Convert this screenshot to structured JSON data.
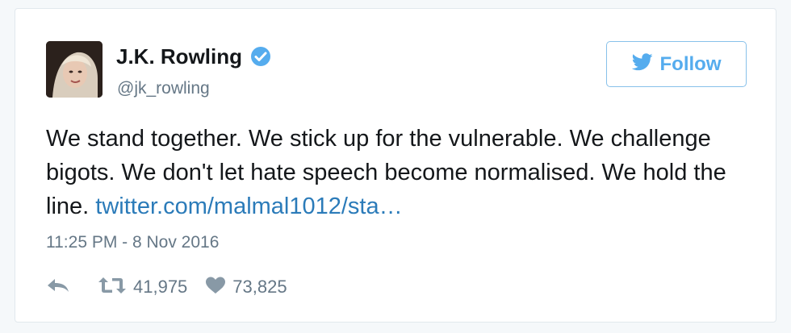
{
  "tweet": {
    "author": {
      "display_name": "J.K. Rowling",
      "handle": "@jk_rowling",
      "verified": true
    },
    "follow_label": "Follow",
    "text_main": "We stand together. We stick up for the vulnerable. We challenge bigots. We don't let hate speech become normalised. We hold the line.",
    "link_text": "twitter.com/malmal1012/sta…",
    "timestamp": "11:25 PM - 8 Nov 2016",
    "retweet_count": "41,975",
    "like_count": "73,825"
  },
  "colors": {
    "brand_blue": "#55acee",
    "link_blue": "#2b7bb9",
    "muted": "#657786",
    "text": "#14171a",
    "border": "#e1e8ed"
  },
  "icons": {
    "verified": "verified-badge-icon",
    "follow_bird": "twitter-bird-icon",
    "reply": "reply-icon",
    "retweet": "retweet-icon",
    "like": "heart-icon"
  }
}
